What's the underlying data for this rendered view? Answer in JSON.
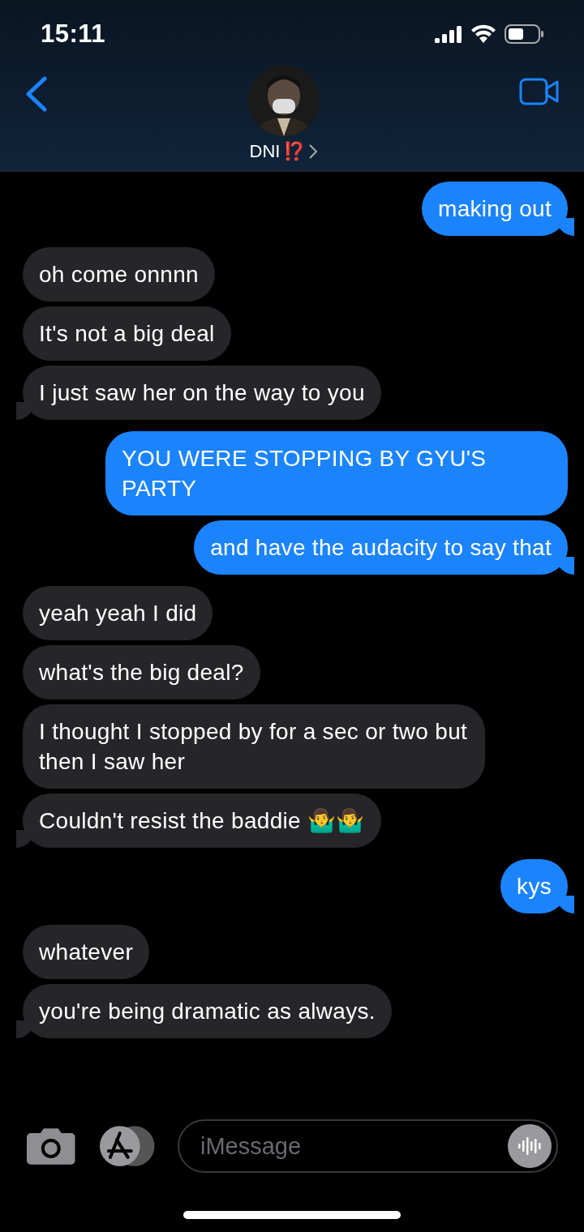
{
  "status_bar": {
    "time": "15:11"
  },
  "header": {
    "name": "DNI",
    "badge": "⁉️"
  },
  "messages": [
    {
      "kind": "sent",
      "text": "making out",
      "tail": true
    },
    {
      "kind": "received",
      "text": "oh come onnnn",
      "tail": false
    },
    {
      "kind": "received",
      "text": "It's not a big deal",
      "tail": false
    },
    {
      "kind": "received",
      "text": "I just saw her on the way to you",
      "tail": true
    },
    {
      "kind": "sent",
      "text": "YOU WERE STOPPING BY GYU'S PARTY",
      "tail": false
    },
    {
      "kind": "sent",
      "text": "and have the audacity to say that",
      "tail": true
    },
    {
      "kind": "received",
      "text": "yeah yeah I did",
      "tail": false
    },
    {
      "kind": "received",
      "text": "what's the big deal?",
      "tail": false
    },
    {
      "kind": "received",
      "text": "I thought I stopped by for a sec or two but then I saw her",
      "tail": false
    },
    {
      "kind": "received",
      "text": "Couldn't resist the baddie 🤷‍♂️🤷‍♂️",
      "tail": true
    },
    {
      "kind": "sent",
      "text": "kys",
      "tail": true
    },
    {
      "kind": "received",
      "text": "whatever",
      "tail": false
    },
    {
      "kind": "received",
      "text": "you're being dramatic as always.",
      "tail": true
    }
  ],
  "composer": {
    "placeholder": "iMessage"
  }
}
